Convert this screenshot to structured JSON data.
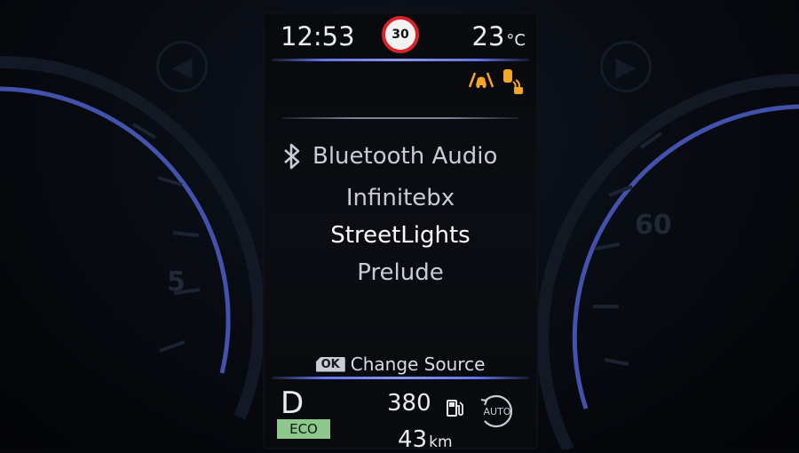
{
  "status_bar": {
    "clock": "12:53",
    "speed_limit": "30",
    "temperature": "23",
    "temperature_unit": "°C"
  },
  "audio": {
    "source_label": "Bluetooth Audio",
    "tracks": [
      "Infinitebx",
      "StreetLights",
      "Prelude"
    ],
    "current_track_index": 1
  },
  "ok_hint": {
    "badge": "OK",
    "label": "Change Source"
  },
  "drive": {
    "gear": "D",
    "mode": "ECO",
    "range_value": "380",
    "distance_value": "43",
    "distance_unit": "km",
    "auto_label": "AUTO"
  },
  "background_gauges": {
    "left_number": "5",
    "right_number": "60"
  },
  "icons": [
    "bluetooth-icon",
    "lane-departure-warning-icon",
    "blind-spot-warning-icon",
    "fuel-pump-icon",
    "auto-hold-icon",
    "left-arrow-icon",
    "right-arrow-icon"
  ],
  "colors": {
    "accent_blue": "#6475e6",
    "speed_sign_red": "#d8232a",
    "warning_amber": "#f5a623",
    "eco_green": "#8ec78c"
  }
}
